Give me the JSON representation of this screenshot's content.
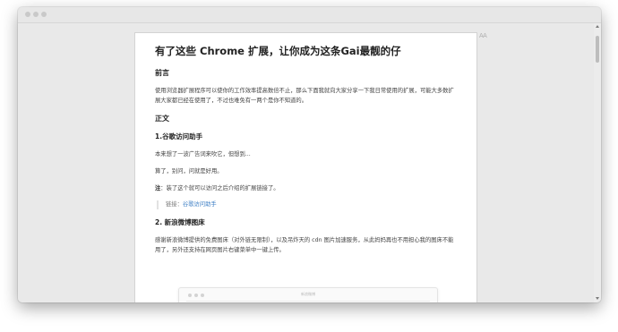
{
  "article": {
    "title": "有了这些 Chrome 扩展，让你成为这条Gai最靓的仔",
    "sections": {
      "preface_heading": "前言",
      "preface_text": "使用浏览器扩展程序可以使你的工作效率提高数倍不止，那么下面我就向大家分享一下我日常使用的扩展，可能大多数扩展大家都已经在使用了，不过也难免有一两个是你不知道的。",
      "body_heading": "正文",
      "item1_heading": "1.谷歌访问助手",
      "item1_p1": "本来想了一波广告词来吹它，但想到...",
      "item1_p2": "算了，别问，问就是好用。",
      "item1_note_label": "注",
      "item1_note_text": "：装了这个就可以访问之后介绍的扩展链接了。",
      "item1_link_label": "链接：",
      "item1_link_text": "谷歌访问助手",
      "item2_heading": "2. 新浪微博图床",
      "item2_text": "感谢新浪微博提供的免费图床（对外链无限制），以及吊炸天的 cdn 图片加速服务，从此妈妈再也不用担心我的图床不能用了，另外还支持在网页图片右键菜单中一键上传。",
      "embedded_title": "新浪微博"
    }
  },
  "toolbar": {
    "font_toggle": "AA"
  },
  "icons": {
    "traffic_lights": "window-dots-icon",
    "scroll_up": "arrow-up-icon",
    "scroll_down": "arrow-down-icon"
  },
  "colors": {
    "link": "#3e7fc5",
    "background": "#e9e9e9",
    "page": "#ffffff"
  }
}
